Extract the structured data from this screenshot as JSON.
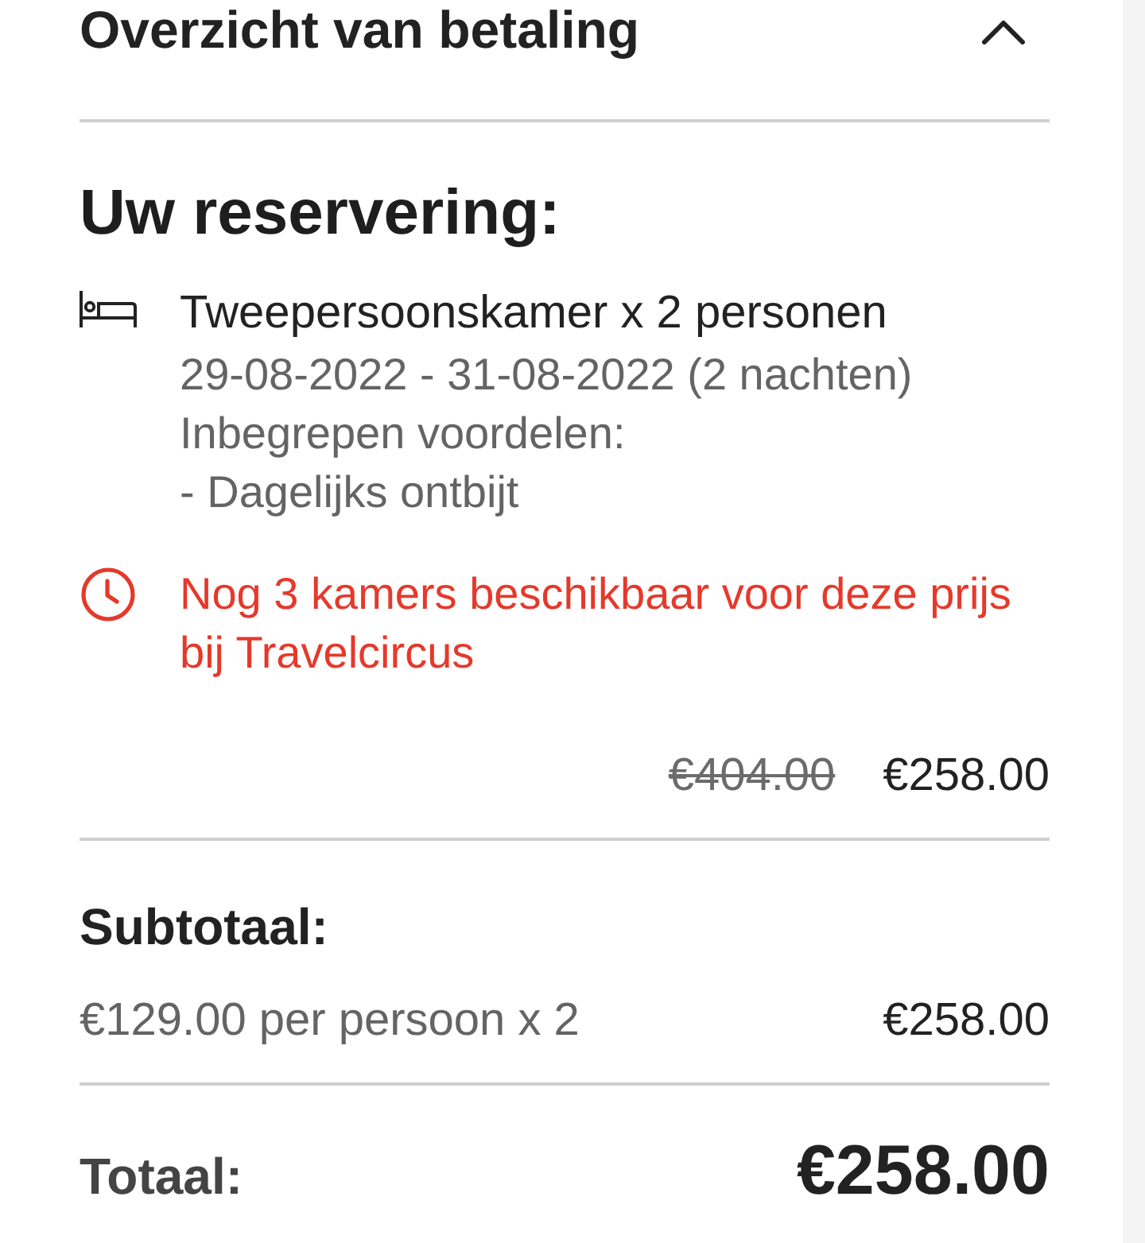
{
  "header": {
    "title": "Overzicht van betaling",
    "expanded": true
  },
  "reservation": {
    "heading": "Uw reservering:",
    "room": {
      "title": "Tweepersoonskamer x 2 personen",
      "details": [
        "29-08-2022 - 31-08-2022 (2 nachten)",
        "Inbegrepen voordelen:",
        "- Dagelijks ontbijt"
      ]
    },
    "notice": {
      "text": "Nog 3 kamers beschikbaar voor deze prijs bij Travelcircus"
    },
    "price": {
      "original": "€404.00",
      "current": "€258.00"
    }
  },
  "subtotal": {
    "label": "Subtotaal:",
    "rows": [
      {
        "description": "€129.00 per persoon x 2",
        "amount": "€258.00"
      }
    ]
  },
  "total": {
    "label": "Totaal:",
    "amount": "€258.00"
  }
}
